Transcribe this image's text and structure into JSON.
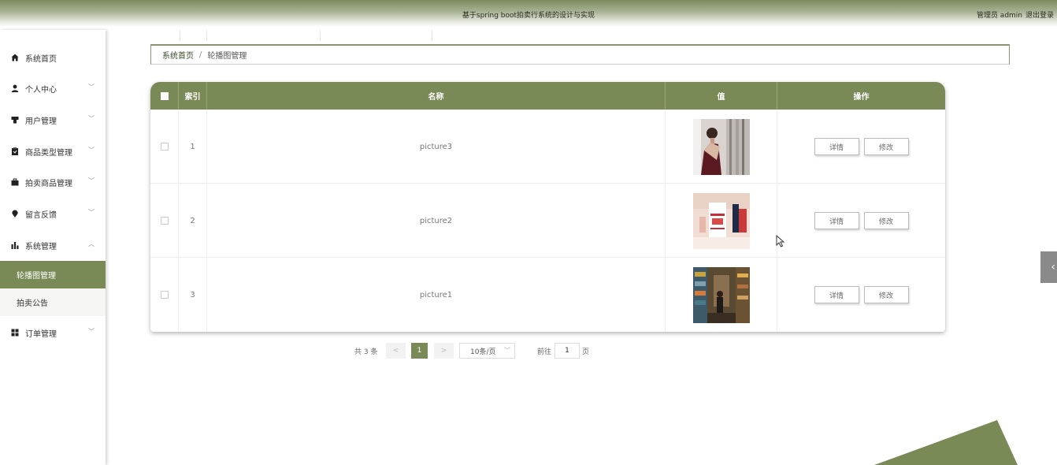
{
  "header": {
    "title": "基于spring boot拍卖行系统的设计与实现",
    "admin_label": "管理员 admin",
    "logout_label": "退出登录"
  },
  "sidebar": {
    "items": [
      {
        "label": "系统首页",
        "icon": "home-icon"
      },
      {
        "label": "个人中心",
        "icon": "user-icon"
      },
      {
        "label": "用户管理",
        "icon": "users-icon"
      },
      {
        "label": "商品类型管理",
        "icon": "clipboard-icon"
      },
      {
        "label": "拍卖商品管理",
        "icon": "briefcase-icon"
      },
      {
        "label": "留言反馈",
        "icon": "pin-icon"
      },
      {
        "label": "系统管理",
        "icon": "bar-chart-icon"
      },
      {
        "label": "订单管理",
        "icon": "grid-icon"
      }
    ],
    "sub_items": [
      {
        "label": "轮播图管理",
        "active": true
      },
      {
        "label": "拍卖公告",
        "active": false
      }
    ]
  },
  "breadcrumb": {
    "home": "系统首页",
    "separator": "/",
    "current": "轮播图管理"
  },
  "table": {
    "headers": [
      "索引",
      "名称",
      "值",
      "操作"
    ],
    "rows": [
      {
        "index": "1",
        "name": "picture3",
        "thumb": "photo-woman-icon"
      },
      {
        "index": "2",
        "name": "picture2",
        "thumb": "photo-shopping-icon"
      },
      {
        "index": "3",
        "name": "picture1",
        "thumb": "photo-bookstore-icon"
      }
    ],
    "detail_label": "详情",
    "edit_label": "修改"
  },
  "pagination": {
    "total": "共 3 条",
    "prev": "<",
    "current_page": "1",
    "next": ">",
    "page_size": "10条/页",
    "goto_label": "前往",
    "goto_value": "1",
    "page_suffix": "页"
  },
  "colors": {
    "accent": "#7a8a57",
    "header_dark": "#7d8a5d"
  }
}
